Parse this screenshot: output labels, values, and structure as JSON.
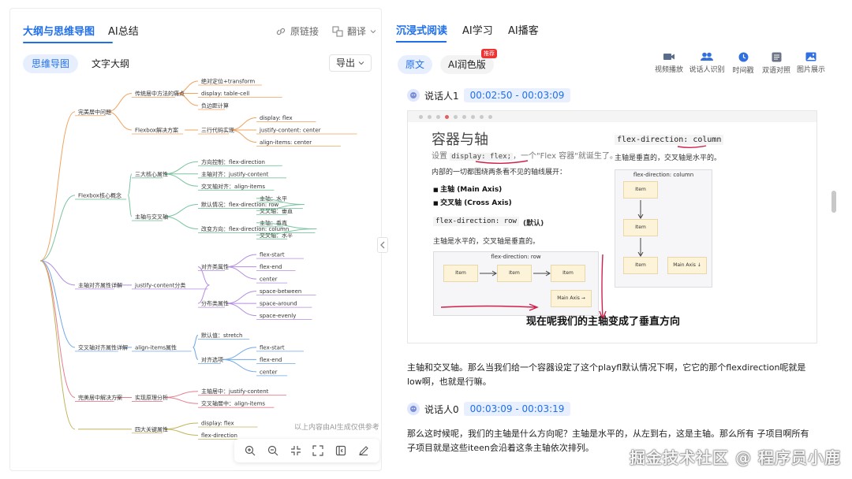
{
  "left": {
    "tabs": [
      "大纲与思维导图",
      "AI总结"
    ],
    "actions": {
      "link": "原链接",
      "translate": "翻译"
    },
    "subtabs": [
      "思维导图",
      "文字大纲"
    ],
    "export": "导出",
    "mindmap": {
      "groups": [
        {
          "label": "完美居中问题",
          "children": [
            {
              "label": "传统居中方法的痛点",
              "children": [
                "绝对定位+transform",
                "display: table-cell",
                "负边距计算"
              ]
            },
            {
              "label": "Flexbox解决方案",
              "children": [
                {
                  "label": "三行代码实现",
                  "children": [
                    "display: flex",
                    "justify-content: center",
                    "align-items: center"
                  ]
                }
              ]
            }
          ]
        },
        {
          "label": "Flexbox核心概念",
          "children": [
            {
              "label": "三大核心属性",
              "children": [
                "方向控制：flex-direction",
                "主轴对齐：justify-content",
                "交叉轴对齐：align-items"
              ]
            },
            {
              "label": "主轴与交叉轴",
              "children": [
                {
                  "label": "默认情况：flex-direction: row",
                  "children": [
                    "主轴：水平",
                    "交叉轴：垂直"
                  ]
                },
                {
                  "label": "改变方向：flex-direction: column",
                  "children": [
                    "主轴：垂直",
                    "交叉轴：水平"
                  ]
                }
              ]
            }
          ]
        },
        {
          "label": "主轴对齐属性详解",
          "children": [
            {
              "label": "justify-content分类",
              "children": [
                {
                  "label": "对齐类属性",
                  "children": [
                    "flex-start",
                    "flex-end",
                    "center"
                  ]
                },
                {
                  "label": "分布类属性",
                  "children": [
                    "space-between",
                    "space-around",
                    "space-evenly"
                  ]
                }
              ]
            }
          ]
        },
        {
          "label": "交叉轴对齐属性详解",
          "children": [
            {
              "label": "align-items属性",
              "children": [
                "默认值：stretch",
                {
                  "label": "对齐选项",
                  "children": [
                    "flex-start",
                    "flex-end",
                    "center"
                  ]
                }
              ]
            }
          ]
        },
        {
          "label": "完美居中解决方案",
          "children": [
            {
              "label": "实现原理分析",
              "children": [
                "主轴居中：justify-content",
                "交叉轴居中：align-items"
              ]
            }
          ]
        },
        {
          "label": "",
          "children": [
            {
              "label": "四大关键属性",
              "children": [
                "display: flex",
                "flex-direction"
              ]
            }
          ]
        }
      ]
    },
    "footnote": "以上内容由AI生成仅供参考"
  },
  "right": {
    "tabs": [
      "沉浸式阅读",
      "AI学习",
      "AI播客"
    ],
    "subtabs": [
      "原文",
      "AI润色版"
    ],
    "badge": "推荐",
    "tools": [
      "视频播放",
      "说话人识别",
      "时间戳",
      "双语对照",
      "图片展示"
    ],
    "seg1": {
      "speaker": "说话人1",
      "time": "00:02:50 - 00:03:09"
    },
    "slide": {
      "title": "容器与轴",
      "subtitle_prefix": "设置",
      "subtitle_code": "display: flex;",
      "subtitle_suffix": "，一个\"Flex 容器\"就诞生了。",
      "body": "内部的一切都围绕两条看不见的轴线展开：",
      "bullets": [
        "主轴 (Main Axis)",
        "交叉轴 (Cross Axis)"
      ],
      "code_row": "flex-direction: row",
      "code_row_suffix": "(默认)",
      "note_row": "主轴是水平的，交叉轴是垂直的。",
      "code_col": "flex-direction: column",
      "note_col": "主轴是垂直的，交叉轴是水平的。",
      "box_row_title": "flex-direction: row",
      "box_col_title": "flex-direction: column",
      "item": "Item",
      "main_axis_row": "Main Axis →",
      "main_axis_col": "Main Axis ↓",
      "caption": "现在呢我们的主轴变成了垂直方向"
    },
    "para1": "主轴和交叉轴。那么当我们给一个容器设定了这个playfl默认情况下啊，它它的那个flexdirection呢就是low啊，也就是行嘛。",
    "seg2": {
      "speaker": "说话人0",
      "time": "00:03:09 - 00:03:19"
    },
    "para2": "那么这时候呢，我们的主轴是什么方向呢？主轴是水平的，从左到右，这是主轴。那么所有 子项目啊所有子项目就是这些iteen会沿着这条主轴依次排列。"
  },
  "watermark": "掘金技术社区 @ 程序员小鹿",
  "colors": {
    "accent": "#1f6feb",
    "badge": "#ee3333"
  }
}
